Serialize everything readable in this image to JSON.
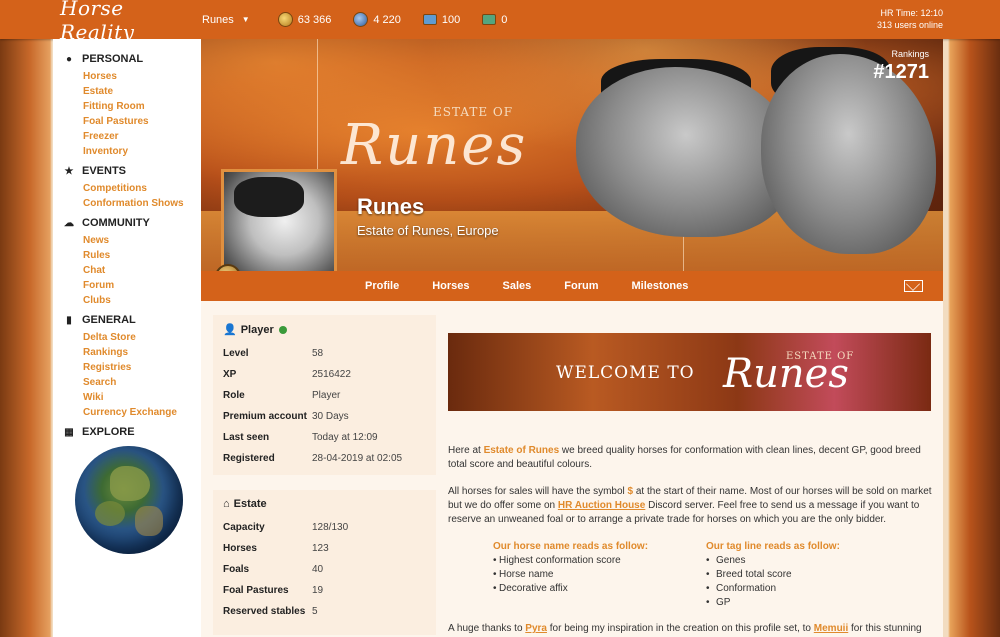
{
  "topbar": {
    "logo": "Horse Reality",
    "player_menu": "Runes",
    "currency1": "63 366",
    "currency2": "4 220",
    "currency3": "100",
    "currency4": "0",
    "hr_time": "HR Time: 12:10",
    "users_online": "313 users online"
  },
  "sidebar": {
    "personal": {
      "title": "PERSONAL",
      "items": [
        "Horses",
        "Estate",
        "Fitting Room",
        "Foal Pastures",
        "Freezer",
        "Inventory"
      ]
    },
    "events": {
      "title": "EVENTS",
      "items": [
        "Competitions",
        "Conformation Shows"
      ]
    },
    "community": {
      "title": "COMMUNITY",
      "items": [
        "News",
        "Rules",
        "Chat",
        "Forum",
        "Clubs"
      ]
    },
    "general": {
      "title": "GENERAL",
      "items": [
        "Delta Store",
        "Rankings",
        "Registries",
        "Search",
        "Wiki",
        "Currency Exchange"
      ]
    },
    "explore": {
      "title": "EXPLORE"
    }
  },
  "banner": {
    "estate_of": "ESTATE OF",
    "script_title": "Runes",
    "rankings_label": "Rankings",
    "rankings_value": "#1271",
    "player_name": "Runes",
    "player_subtitle": "Estate of Runes, Europe"
  },
  "tabs": [
    "Profile",
    "Horses",
    "Sales",
    "Forum",
    "Milestones"
  ],
  "player_card": {
    "title": "Player",
    "rows": [
      {
        "k": "Level",
        "v": "58"
      },
      {
        "k": "XP",
        "v": "2516422"
      },
      {
        "k": "Role",
        "v": "Player"
      },
      {
        "k": "Premium account",
        "v": "30 Days"
      },
      {
        "k": "Last seen",
        "v": "Today at 12:09"
      },
      {
        "k": "Registered",
        "v": "28-04-2019 at 02:05"
      }
    ]
  },
  "estate_card": {
    "title": "Estate",
    "rows": [
      {
        "k": "Capacity",
        "v": "128/130"
      },
      {
        "k": "Horses",
        "v": "123"
      },
      {
        "k": "Foals",
        "v": "40"
      },
      {
        "k": "Foal Pastures",
        "v": "19"
      },
      {
        "k": "Reserved stables",
        "v": "5"
      }
    ]
  },
  "welcome": {
    "welcome_to": "WELCOME TO",
    "estate_of": "ESTATE OF",
    "script": "Runes"
  },
  "content": {
    "p1_a": "Here at ",
    "p1_link": "Estate of Runes",
    "p1_b": " we breed quality horses for conformation with clean lines, decent GP, good breed total score and beautiful colours.",
    "p2_a": "All horses for sales will have the symbol ",
    "p2_sym": "$",
    "p2_b": " at the start of their name. Most of our horses will be sold on market but we do offer some on ",
    "p2_link": "HR Auction House",
    "p2_c": " Discord server. Feel free to send us a message if you want to reserve an unweaned foal or to arrange a private trade for horses on which you are the only bidder.",
    "col1_title": "Our horse name reads as follow:",
    "col1_items": [
      "Highest conformation score",
      "Horse name",
      "Decorative affix"
    ],
    "col2_title": "Our tag line reads as follow:",
    "col2_items": [
      "Genes",
      "Breed total score",
      "Conformation",
      "GP"
    ],
    "p4_a": "A huge thanks to ",
    "p4_link1": "Pyra",
    "p4_b": " for being my inspiration in the creation on this profile set, to ",
    "p4_link2": "Memuii",
    "p4_c": " for this stunning"
  }
}
